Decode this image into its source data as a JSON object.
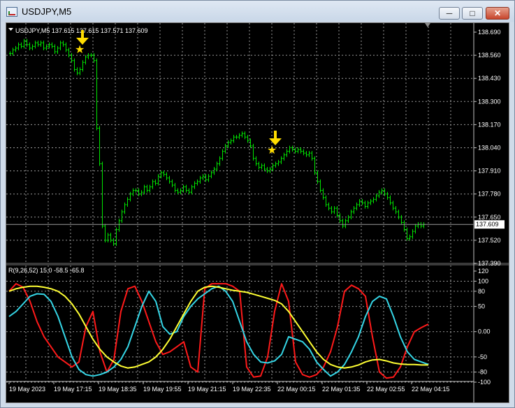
{
  "window": {
    "title": "USDJPY,M5"
  },
  "controls": {
    "minimize": "─",
    "maximize": "□",
    "close": "✕"
  },
  "price_header": "USDJPY,M5  137.615 137.615 137.571 137.609",
  "indicator_header": "R(9,26,52) 15.0 -58.5 -65.8",
  "current_price_label": "137.609",
  "colors": {
    "candles": "#00e600",
    "grid": "#9a9a9a",
    "background": "#000000",
    "red_line": "#ff1a1a",
    "cyan_line": "#35d6e6",
    "yellow_line": "#ffff33",
    "marker": "#ffdd00"
  },
  "chart_data": [
    {
      "type": "line",
      "title": "USDJPY,M5",
      "x_tick_labels": [
        "19 May 2023",
        "19 May 17:15",
        "19 May 18:35",
        "19 May 19:55",
        "19 May 21:15",
        "19 May 22:35",
        "22 May 00:15",
        "22 May 01:35",
        "22 May 02:55",
        "22 May 04:15"
      ],
      "y_tick_labels": [
        "138.690",
        "138.560",
        "138.430",
        "138.300",
        "138.170",
        "138.040",
        "137.910",
        "137.780",
        "137.650",
        "137.520",
        "137.390"
      ],
      "ylim": [
        137.39,
        138.69
      ],
      "current_price": 137.609,
      "x": [
        0,
        4,
        8,
        12,
        16,
        20,
        24,
        28,
        32,
        36,
        40,
        44,
        48,
        52,
        56,
        60,
        64,
        68,
        72,
        76,
        80,
        84,
        88,
        92,
        96,
        100,
        104,
        108,
        112,
        116,
        120,
        124,
        128,
        132,
        136,
        140,
        144,
        148,
        152,
        156,
        160,
        164,
        168,
        172,
        176,
        180,
        184,
        188,
        192,
        196,
        200,
        204,
        208,
        212,
        216,
        220,
        224,
        228,
        232,
        236,
        240,
        244,
        248,
        252,
        256,
        260,
        264,
        268,
        272,
        276,
        280,
        284,
        288,
        292,
        296,
        300,
        304,
        308,
        312,
        316,
        320,
        324,
        328,
        332,
        336,
        340,
        344,
        348,
        352,
        356,
        360,
        364,
        368,
        372,
        376,
        380,
        384,
        388,
        392,
        396,
        400,
        404,
        408,
        412,
        416,
        420,
        424,
        428,
        432,
        436,
        440,
        444,
        448,
        452,
        456,
        460,
        464,
        468,
        472,
        476,
        480,
        484,
        488,
        492,
        496,
        500,
        504,
        508,
        512,
        516,
        520,
        524,
        528,
        532,
        536,
        540,
        544,
        548,
        552,
        556,
        560,
        564,
        568,
        572,
        576,
        580,
        584,
        588,
        592,
        596,
        600,
        604
      ],
      "close": [
        138.57,
        138.59,
        138.6,
        138.62,
        138.61,
        138.64,
        138.62,
        138.6,
        138.61,
        138.63,
        138.62,
        138.63,
        138.6,
        138.61,
        138.62,
        138.61,
        138.58,
        138.6,
        138.63,
        138.62,
        138.59,
        138.56,
        138.53,
        138.48,
        138.46,
        138.48,
        138.52,
        138.55,
        138.56,
        138.56,
        138.53,
        138.15,
        137.95,
        137.6,
        137.52,
        137.55,
        137.52,
        137.5,
        137.58,
        137.63,
        137.68,
        137.72,
        137.75,
        137.78,
        137.8,
        137.8,
        137.78,
        137.79,
        137.82,
        137.8,
        137.82,
        137.85,
        137.84,
        137.88,
        137.9,
        137.89,
        137.87,
        137.85,
        137.83,
        137.8,
        137.79,
        137.8,
        137.82,
        137.8,
        137.79,
        137.82,
        137.84,
        137.85,
        137.87,
        137.88,
        137.86,
        137.88,
        137.9,
        137.92,
        137.95,
        137.98,
        138.02,
        138.05,
        138.07,
        138.08,
        138.1,
        138.1,
        138.11,
        138.12,
        138.1,
        138.08,
        138.05,
        137.98,
        137.95,
        137.93,
        137.94,
        137.92,
        137.91,
        137.92,
        137.94,
        137.95,
        137.96,
        137.98,
        138.0,
        138.02,
        138.04,
        138.03,
        138.02,
        138.03,
        138.02,
        138.01,
        138.0,
        138.01,
        137.98,
        137.9,
        137.85,
        137.8,
        137.76,
        137.72,
        137.7,
        137.68,
        137.7,
        137.66,
        137.63,
        137.6,
        137.63,
        137.65,
        137.68,
        137.7,
        137.72,
        137.74,
        137.73,
        137.71,
        137.73,
        137.74,
        137.75,
        137.77,
        137.79,
        137.8,
        137.78,
        137.76,
        137.73,
        137.7,
        137.68,
        137.65,
        137.62,
        137.58,
        137.53,
        137.54,
        137.57,
        137.6,
        137.61,
        137.6,
        137.609
      ]
    },
    {
      "type": "line",
      "title": "R(9,26,52)",
      "y_tick_labels": [
        "120",
        "100",
        "80",
        "50",
        "0.00",
        "-50",
        "-80",
        "-100"
      ],
      "ylim": [
        -100,
        120
      ],
      "x_tick_labels": [
        "19 May 2023",
        "19 May 17:15",
        "19 May 18:35",
        "19 May 19:55",
        "19 May 21:15",
        "19 May 22:35",
        "22 May 00:15",
        "22 May 01:35",
        "22 May 02:55",
        "22 May 04:15"
      ],
      "x": [
        0,
        10,
        20,
        30,
        40,
        50,
        60,
        70,
        80,
        90,
        100,
        110,
        120,
        130,
        140,
        150,
        160,
        170,
        180,
        190,
        200,
        210,
        220,
        230,
        240,
        250,
        260,
        270,
        280,
        290,
        300,
        310,
        320,
        330,
        340,
        350,
        360,
        370,
        380,
        390,
        400,
        410,
        420,
        430,
        440,
        450,
        460,
        470,
        480,
        490,
        500,
        510,
        520,
        530,
        540,
        550,
        560,
        570,
        580,
        590,
        600
      ],
      "series": [
        {
          "color": "#ff1a1a",
          "values": [
            80,
            95,
            88,
            60,
            20,
            -10,
            -30,
            -50,
            -60,
            -70,
            -60,
            10,
            40,
            -40,
            -80,
            -55,
            40,
            85,
            90,
            60,
            20,
            -20,
            -45,
            -40,
            -30,
            -20,
            -70,
            -80,
            85,
            95,
            95,
            95,
            90,
            80,
            -70,
            -90,
            -88,
            -50,
            40,
            95,
            60,
            -60,
            -85,
            -90,
            -85,
            -70,
            -40,
            10,
            80,
            92,
            85,
            70,
            -10,
            -80,
            -92,
            -90,
            -70,
            -30,
            0,
            8,
            15
          ]
        },
        {
          "color": "#35d6e6",
          "values": [
            30,
            40,
            55,
            70,
            75,
            74,
            60,
            30,
            -10,
            -50,
            -75,
            -85,
            -88,
            -85,
            -80,
            -70,
            -55,
            -30,
            10,
            50,
            80,
            60,
            10,
            -5,
            0,
            30,
            50,
            65,
            75,
            85,
            90,
            80,
            60,
            20,
            -20,
            -45,
            -60,
            -62,
            -58,
            -45,
            -10,
            -15,
            -20,
            -35,
            -60,
            -75,
            -88,
            -80,
            -65,
            -40,
            -10,
            30,
            60,
            70,
            65,
            30,
            -10,
            -40,
            -55,
            -60,
            -65
          ]
        },
        {
          "color": "#ffff33",
          "values": [
            80,
            85,
            88,
            90,
            90,
            88,
            85,
            80,
            70,
            55,
            35,
            10,
            -15,
            -35,
            -50,
            -60,
            -68,
            -72,
            -70,
            -65,
            -60,
            -50,
            -35,
            -15,
            10,
            35,
            60,
            80,
            88,
            90,
            88,
            85,
            82,
            80,
            78,
            74,
            70,
            66,
            62,
            55,
            40,
            20,
            0,
            -20,
            -40,
            -55,
            -65,
            -70,
            -72,
            -70,
            -66,
            -60,
            -56,
            -55,
            -58,
            -62,
            -64,
            -65,
            -65,
            -66,
            -66
          ]
        }
      ]
    }
  ]
}
